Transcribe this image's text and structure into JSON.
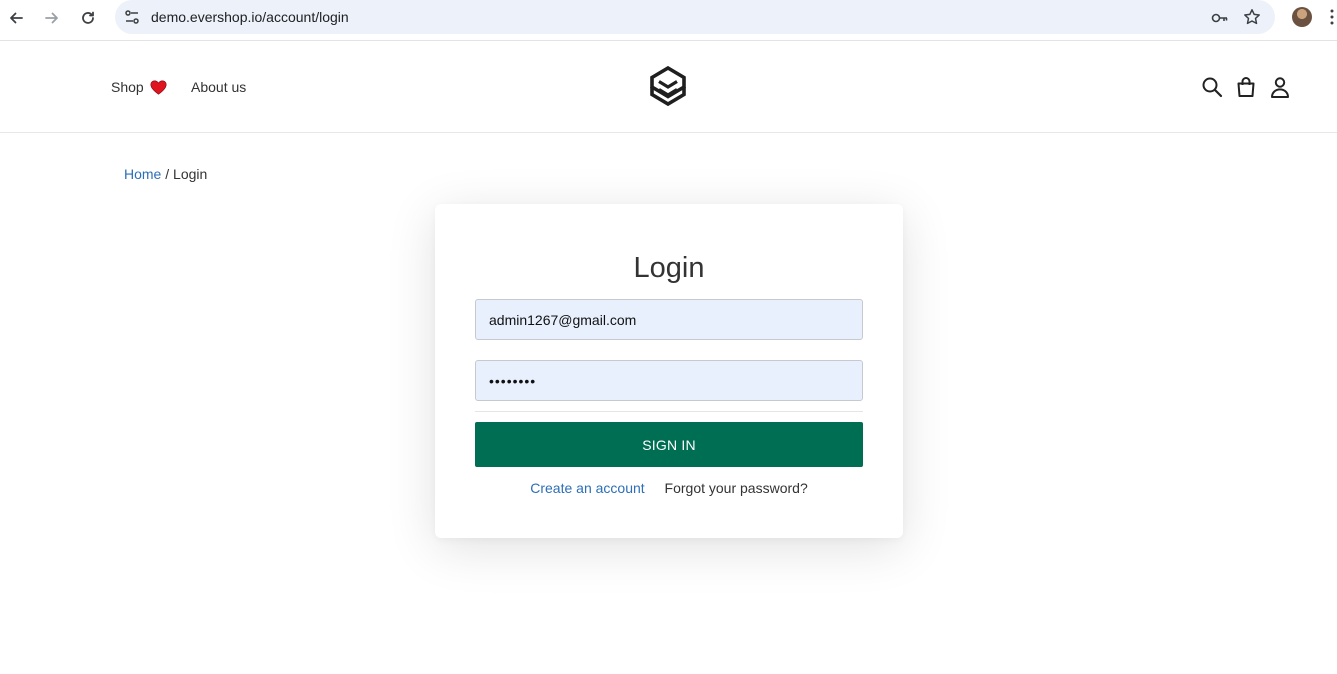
{
  "browser": {
    "url": "demo.evershop.io/account/login",
    "icons": [
      "back-arrow-icon",
      "forward-arrow-icon",
      "reload-icon",
      "site-settings-icon",
      "password-key-icon",
      "bookmark-star-icon",
      "profile-avatar",
      "more-menu-icon"
    ]
  },
  "header": {
    "menu": [
      {
        "label": "Shop"
      },
      {
        "label": "About us"
      }
    ],
    "icons": [
      "search-icon",
      "cart-icon",
      "user-icon"
    ],
    "heart_color": "#e0141e"
  },
  "breadcrumb": {
    "home": "Home",
    "separator": "/",
    "current": "Login"
  },
  "login": {
    "title": "Login",
    "email_value": "admin1267@gmail.com",
    "password_value": "••••••••",
    "submit_label": "SIGN IN",
    "create_account": "Create an account",
    "forgot_password": "Forgot your password?"
  },
  "colors": {
    "primary_button": "#006e52",
    "link": "#2c6fb7",
    "autofill_bg": "#e8f0fe"
  }
}
